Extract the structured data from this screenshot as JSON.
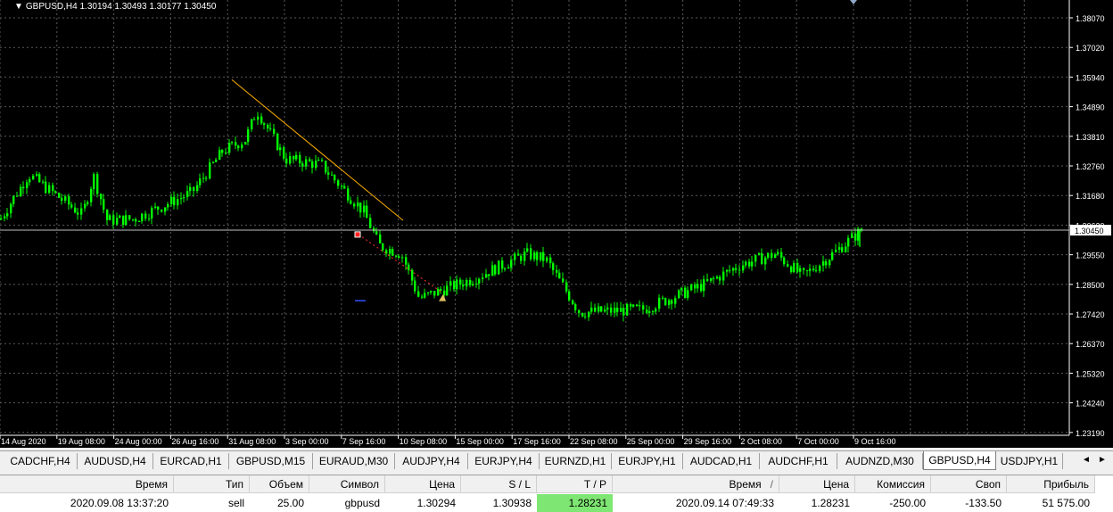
{
  "chart": {
    "title": "GBPUSD,H4  1.30194 1.30493 1.30177 1.30450",
    "symbol": "GBPUSD",
    "timeframe": "H4",
    "ohlc": {
      "open": "1.30194",
      "high": "1.30493",
      "low": "1.30177",
      "close": "1.30450"
    },
    "current_price_label": "1.30450",
    "colors": {
      "background": "#000000",
      "candle": "#00ff00",
      "grid": "#5a5a5a",
      "axis_text": "#ffffff",
      "trendline": "#ffb000",
      "price_line": "#c0c0c0"
    }
  },
  "chart_data": {
    "type": "candlestick",
    "price_axis": [
      "1.38070",
      "1.37020",
      "1.35940",
      "1.34890",
      "1.33810",
      "1.32760",
      "1.31680",
      "1.30630",
      "1.29550",
      "1.28500",
      "1.27420",
      "1.26370",
      "1.25320",
      "1.24240",
      "1.23190"
    ],
    "time_axis": [
      "14 Aug 2020",
      "19 Aug 08:00",
      "24 Aug 00:00",
      "26 Aug 16:00",
      "31 Aug 08:00",
      "3 Sep 00:00",
      "7 Sep 16:00",
      "10 Sep 08:00",
      "15 Sep 00:00",
      "17 Sep 16:00",
      "22 Sep 08:00",
      "25 Sep 00:00",
      "29 Sep 16:00",
      "2 Oct 08:00",
      "7 Oct 00:00",
      "9 Oct 16:00"
    ],
    "ylim": [
      1.2319,
      1.3807
    ],
    "approx_close_path": [
      {
        "t": "14 Aug 2020",
        "price": 1.3083
      },
      {
        "t": "17 Aug 2020",
        "price": 1.3245
      },
      {
        "t": "19 Aug 08:00",
        "price": 1.31
      },
      {
        "t": "20 Aug 2020",
        "price": 1.324
      },
      {
        "t": "21 Aug 2020",
        "price": 1.308
      },
      {
        "t": "24 Aug 00:00",
        "price": 1.3085
      },
      {
        "t": "26 Aug 16:00",
        "price": 1.318
      },
      {
        "t": "28 Aug 2020",
        "price": 1.333
      },
      {
        "t": "31 Aug 08:00",
        "price": 1.337
      },
      {
        "t": "1 Sep 2020",
        "price": 1.3475
      },
      {
        "t": "3 Sep 00:00",
        "price": 1.33
      },
      {
        "t": "4 Sep 2020",
        "price": 1.328
      },
      {
        "t": "7 Sep 16:00",
        "price": 1.311
      },
      {
        "t": "8 Sep 2020",
        "price": 1.299
      },
      {
        "t": "10 Sep 08:00",
        "price": 1.296
      },
      {
        "t": "11 Sep 2020",
        "price": 1.28
      },
      {
        "t": "15 Sep 00:00",
        "price": 1.287
      },
      {
        "t": "17 Sep 16:00",
        "price": 1.296
      },
      {
        "t": "18 Sep 2020",
        "price": 1.294
      },
      {
        "t": "22 Sep 08:00",
        "price": 1.275
      },
      {
        "t": "25 Sep 00:00",
        "price": 1.276
      },
      {
        "t": "29 Sep 16:00",
        "price": 1.285
      },
      {
        "t": "2 Oct 08:00",
        "price": 1.292
      },
      {
        "t": "5 Oct 2020",
        "price": 1.296
      },
      {
        "t": "7 Oct 00:00",
        "price": 1.288
      },
      {
        "t": "8 Oct 2020",
        "price": 1.295
      },
      {
        "t": "9 Oct 16:00",
        "price": 1.3045
      }
    ],
    "trendline": [
      {
        "t": "28 Aug 2020",
        "price": 1.3585
      },
      {
        "t": "10 Sep 08:00",
        "price": 1.308
      }
    ],
    "trade_markers": [
      {
        "type": "sell",
        "t": "2020.09.08 13:37:20",
        "price": 1.30294
      },
      {
        "type": "close",
        "t": "2020.09.14 07:49:33",
        "price": 1.28231
      }
    ]
  },
  "tabs": {
    "items": [
      "CADCHF,H4",
      "AUDUSD,H4",
      "EURCAD,H1",
      "GBPUSD,M15",
      "EURAUD,M30",
      "AUDJPY,H4",
      "EURJPY,H4",
      "EURNZD,H1",
      "EURJPY,H1",
      "AUDCAD,H1",
      "AUDCHF,H1",
      "AUDNZD,M30",
      "GBPUSD,H4",
      "USDJPY,H1"
    ],
    "active": "GBPUSD,H4",
    "scroll_left": "◄",
    "scroll_right": "►"
  },
  "terminal": {
    "headers": {
      "time": "Время",
      "type": "Тип",
      "volume": "Объем",
      "symbol": "Символ",
      "price": "Цена",
      "sl": "S / L",
      "tp": "T / P",
      "close_time": "Время",
      "sort_marker": "/",
      "close_price": "Цена",
      "commission": "Комиссия",
      "swap": "Своп",
      "profit": "Прибыль"
    },
    "row": {
      "time": "2020.09.08 13:37:20",
      "type": "sell",
      "volume": "25.00",
      "symbol": "gbpusd",
      "price": "1.30294",
      "sl": "1.30938",
      "tp": "1.28231",
      "close_time": "2020.09.14 07:49:33",
      "close_price": "1.28231",
      "commission": "-250.00",
      "swap": "-133.50",
      "profit": "51 575.00"
    }
  }
}
